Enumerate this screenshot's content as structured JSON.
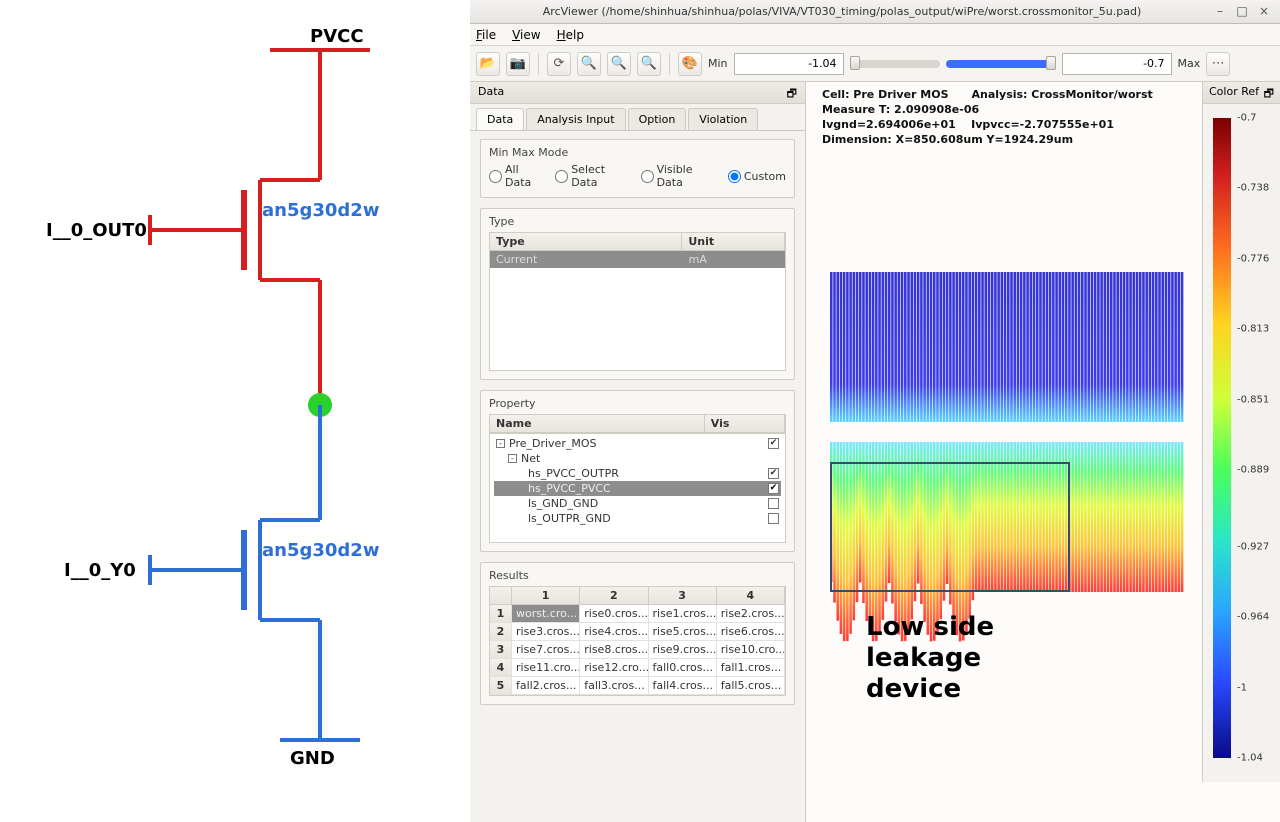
{
  "circuit": {
    "top_rail": "PVCC",
    "bottom_rail": "GND",
    "input_top": "I__0_OUT0",
    "input_bottom": "I__0_Y0",
    "device_top": "an5g30d2w",
    "device_bottom": "an5g30d2w"
  },
  "window": {
    "title": "ArcViewer (/home/shinhua/shinhua/polas/VIVA/VT030_timing/polas_output/wiPre/worst.crossmonitor_5u.pad)",
    "menus": [
      "File",
      "View",
      "Help"
    ],
    "win_buttons": [
      "minimize",
      "maximize",
      "close"
    ]
  },
  "toolbar": {
    "min_label": "Min",
    "min_value": "-1.04",
    "max_label": "Max",
    "max_value": "-0.7"
  },
  "data_dock": {
    "title": "Data",
    "undock_glyph": "🗗",
    "tabs": [
      "Data",
      "Analysis Input",
      "Option",
      "Violation"
    ],
    "active_tab": 0,
    "mode_title": "Min Max Mode",
    "radios": [
      "All Data",
      "Select Data",
      "Visible Data",
      "Custom"
    ],
    "radio_selected": 3,
    "type_title": "Type",
    "type_cols": [
      "Type",
      "Unit"
    ],
    "type_rows": [
      {
        "type": "Current",
        "unit": "mA"
      }
    ],
    "property_title": "Property",
    "property_cols": [
      "Name",
      "Vis"
    ],
    "tree": {
      "root": "Pre_Driver_MOS",
      "group": "Net",
      "items": [
        {
          "name": "hs_PVCC_OUTPR",
          "checked": true,
          "selected": false
        },
        {
          "name": "hs_PVCC_PVCC",
          "checked": true,
          "selected": true
        },
        {
          "name": "ls_GND_GND",
          "checked": false,
          "selected": false
        },
        {
          "name": "ls_OUTPR_GND",
          "checked": false,
          "selected": false
        }
      ]
    },
    "results_title": "Results",
    "results_cols": [
      "",
      "1",
      "2",
      "3",
      "4"
    ],
    "results": [
      [
        "worst.cro...",
        "rise0.cros...",
        "rise1.cros...",
        "rise2.cros..."
      ],
      [
        "rise3.cros...",
        "rise4.cros...",
        "rise5.cros...",
        "rise6.cros..."
      ],
      [
        "rise7.cros...",
        "rise8.cros...",
        "rise9.cros...",
        "rise10.cro..."
      ],
      [
        "rise11.cro...",
        "rise12.cro...",
        "fall0.cros...",
        "fall1.cros..."
      ],
      [
        "fall2.cros...",
        "fall3.cros...",
        "fall4.cros...",
        "fall5.cros..."
      ]
    ]
  },
  "viewer": {
    "meta_line1": "Cell: Pre Driver MOS      Analysis: CrossMonitor/worst",
    "meta_line2": "Measure T: 2.090908e-06",
    "meta_line3": "Ivgnd=2.694006e+01    Ivpvcc=-2.707555e+01",
    "meta_line4": "Dimension: X=850.608um Y=1924.29um",
    "annotation": "Low side\nleakage\ndevice"
  },
  "colorbar": {
    "title": "Color Ref",
    "undock_glyph": "🗗",
    "labels": [
      "-0.7",
      "-0.738",
      "-0.776",
      "-0.813",
      "-0.851",
      "-0.889",
      "-0.927",
      "-0.964",
      "-1",
      "-1.04"
    ]
  }
}
